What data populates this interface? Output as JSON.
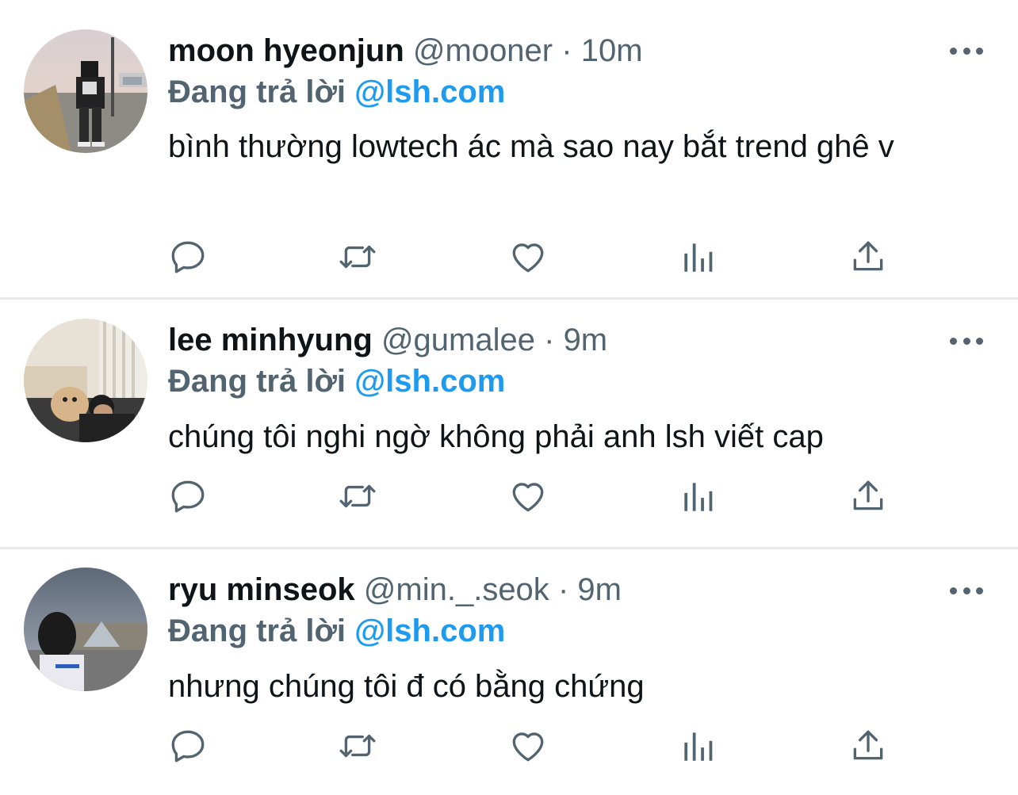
{
  "tweets": [
    {
      "name": "moon hyeonjun",
      "handle": "@mooner",
      "sep": "·",
      "time": "10m",
      "reply_prefix": "Đang trả lời",
      "reply_handle": "@lsh.com",
      "text": "bình thường lowtech ác mà sao nay bắt trend ghê v"
    },
    {
      "name": "lee minhyung",
      "handle": "@gumalee",
      "sep": "·",
      "time": "9m",
      "reply_prefix": "Đang trả lời",
      "reply_handle": "@lsh.com",
      "text": "chúng tôi nghi ngờ không phải anh lsh viết cap"
    },
    {
      "name": "ryu minseok",
      "handle": "@min._.seok",
      "sep": "·",
      "time": "9m",
      "reply_prefix": "Đang trả lời",
      "reply_handle": "@lsh.com",
      "text": "nhưng chúng tôi đ có bằng chứng"
    }
  ],
  "icons": {
    "more": "more-horizontal-icon",
    "reply": "reply-bubble-icon",
    "retweet": "retweet-icon",
    "like": "heart-icon",
    "views": "analytics-bars-icon",
    "share": "share-upload-icon"
  },
  "colors": {
    "link_blue": "#1d9bf0",
    "secondary_gray": "#536471",
    "divider": "#e7e9ec"
  }
}
